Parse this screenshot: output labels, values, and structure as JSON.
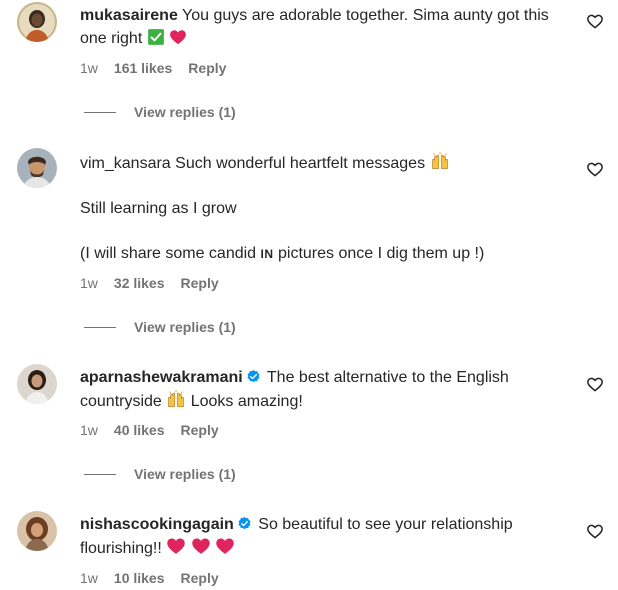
{
  "comments": [
    {
      "username": "mukasairene",
      "verified": false,
      "paragraphs": [
        "You guys are adorable together. Sima aunty got this one right"
      ],
      "emojis": [
        "check-mark-emoji",
        "red-heart-emoji"
      ],
      "time": "1w",
      "likes": "161 likes",
      "reply": "Reply",
      "view_replies": "View replies (1)"
    },
    {
      "username": "vim_kansara",
      "verified": false,
      "paragraphs": [
        "Such wonderful heartfelt messages",
        "Still learning as I grow",
        "(I will share some candid",
        "pictures once I dig them up !)"
      ],
      "in_glyph": "IN",
      "emojis": [
        "raising-hands-emoji"
      ],
      "time": "1w",
      "likes": "32 likes",
      "reply": "Reply",
      "view_replies": "View replies (1)"
    },
    {
      "username": "aparnashewakramani",
      "verified": true,
      "paragraphs": [
        "The best alternative to the English",
        "Looks amazing!"
      ],
      "line2_start": "countryside",
      "emojis": [
        "raising-hands-emoji"
      ],
      "time": "1w",
      "likes": "40 likes",
      "reply": "Reply",
      "view_replies": "View replies (1)"
    },
    {
      "username": "nishascookingagain",
      "verified": true,
      "paragraphs": [
        "So beautiful to see your relationship",
        "flourishing!!"
      ],
      "emojis": [
        "red-heart-emoji",
        "red-heart-emoji",
        "red-heart-emoji"
      ],
      "time": "1w",
      "likes": "10 likes",
      "reply": "Reply"
    }
  ],
  "colors": {
    "text": "#262626",
    "secondary": "#737373",
    "verified_blue": "#0095f6",
    "heart_red": "#e0245e",
    "check_green": "#3cb043"
  }
}
